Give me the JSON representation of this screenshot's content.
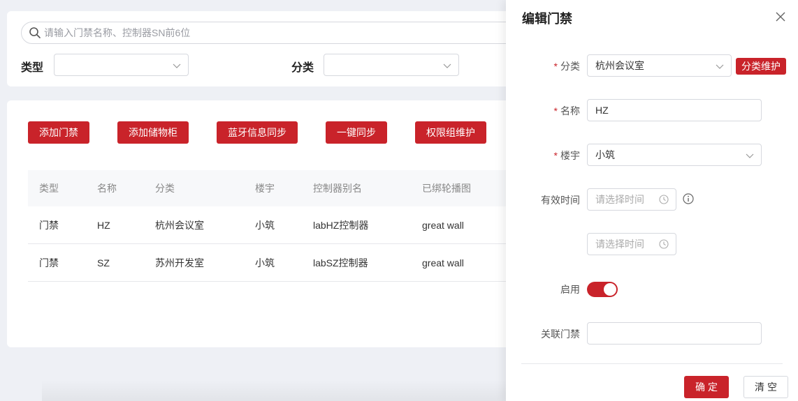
{
  "search": {
    "placeholder": "请输入门禁名称、控制器SN前6位"
  },
  "filters": {
    "type_label": "类型",
    "category_label": "分类"
  },
  "actions": {
    "add_door": "添加门禁",
    "add_locker": "添加储物柜",
    "bluetooth_sync": "蓝牙信息同步",
    "one_click_sync": "一键同步",
    "permission_group": "权限组维护"
  },
  "table": {
    "headers": [
      "类型",
      "名称",
      "分类",
      "楼宇",
      "控制器别名",
      "已绑轮播图"
    ],
    "rows": [
      [
        "门禁",
        "HZ",
        "杭州会议室",
        "小筑",
        "labHZ控制器",
        "great wall"
      ],
      [
        "门禁",
        "SZ",
        "苏州开发室",
        "小筑",
        "labSZ控制器",
        "great wall"
      ]
    ]
  },
  "drawer": {
    "title": "编辑门禁",
    "required_mark": "*",
    "category_label": "分类",
    "category_value": "杭州会议室",
    "category_maintain": "分类维护",
    "name_label": "名称",
    "name_value": "HZ",
    "building_label": "楼宇",
    "building_value": "小筑",
    "valid_time_label": "有效时间",
    "time_placeholder": "请选择时间",
    "enable_label": "启用",
    "enabled": true,
    "linked_door_label": "关联门禁",
    "linked_door_value": "",
    "confirm": "确定",
    "clear": "清空"
  },
  "colors": {
    "accent": "#c9232a",
    "background": "#eef0f5"
  }
}
